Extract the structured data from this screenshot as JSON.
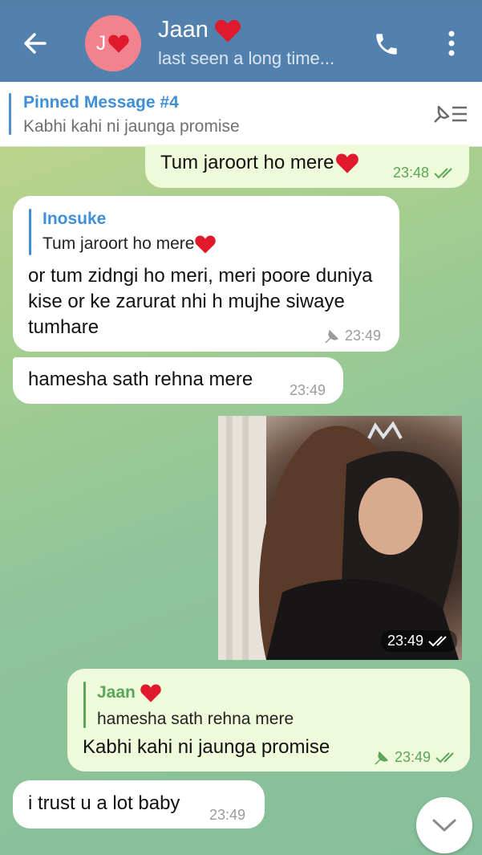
{
  "header": {
    "avatar_initial": "J",
    "name": "Jaan",
    "status": "last seen a long time..."
  },
  "pinned": {
    "title": "Pinned Message #4",
    "text": "Kabhi kahi ni jaunga promise"
  },
  "messages": [
    {
      "text": "Tum jaroort ho mere",
      "time": "23:48"
    },
    {
      "reply_name": "Inosuke",
      "reply_text": "Tum jaroort ho mere",
      "text": "or tum zidngi ho meri, meri poore duniya kise or ke zarurat nhi h mujhe siwaye tumhare",
      "time": "23:49"
    },
    {
      "text": "hamesha sath rehna mere",
      "time": "23:49"
    },
    {
      "time": "23:49"
    },
    {
      "reply_name": "Jaan",
      "reply_text": "hamesha sath rehna mere",
      "text": "Kabhi kahi ni jaunga promise",
      "time": "23:49"
    },
    {
      "text": "i trust u a lot baby",
      "time": "23:49"
    }
  ],
  "colors": {
    "header": "#5281ad",
    "accent": "#3f8ed8",
    "outgoing_bubble": "#eefad9",
    "incoming_bubble": "#ffffff",
    "read_check": "#5aa65b",
    "heart": "#e0192c"
  }
}
